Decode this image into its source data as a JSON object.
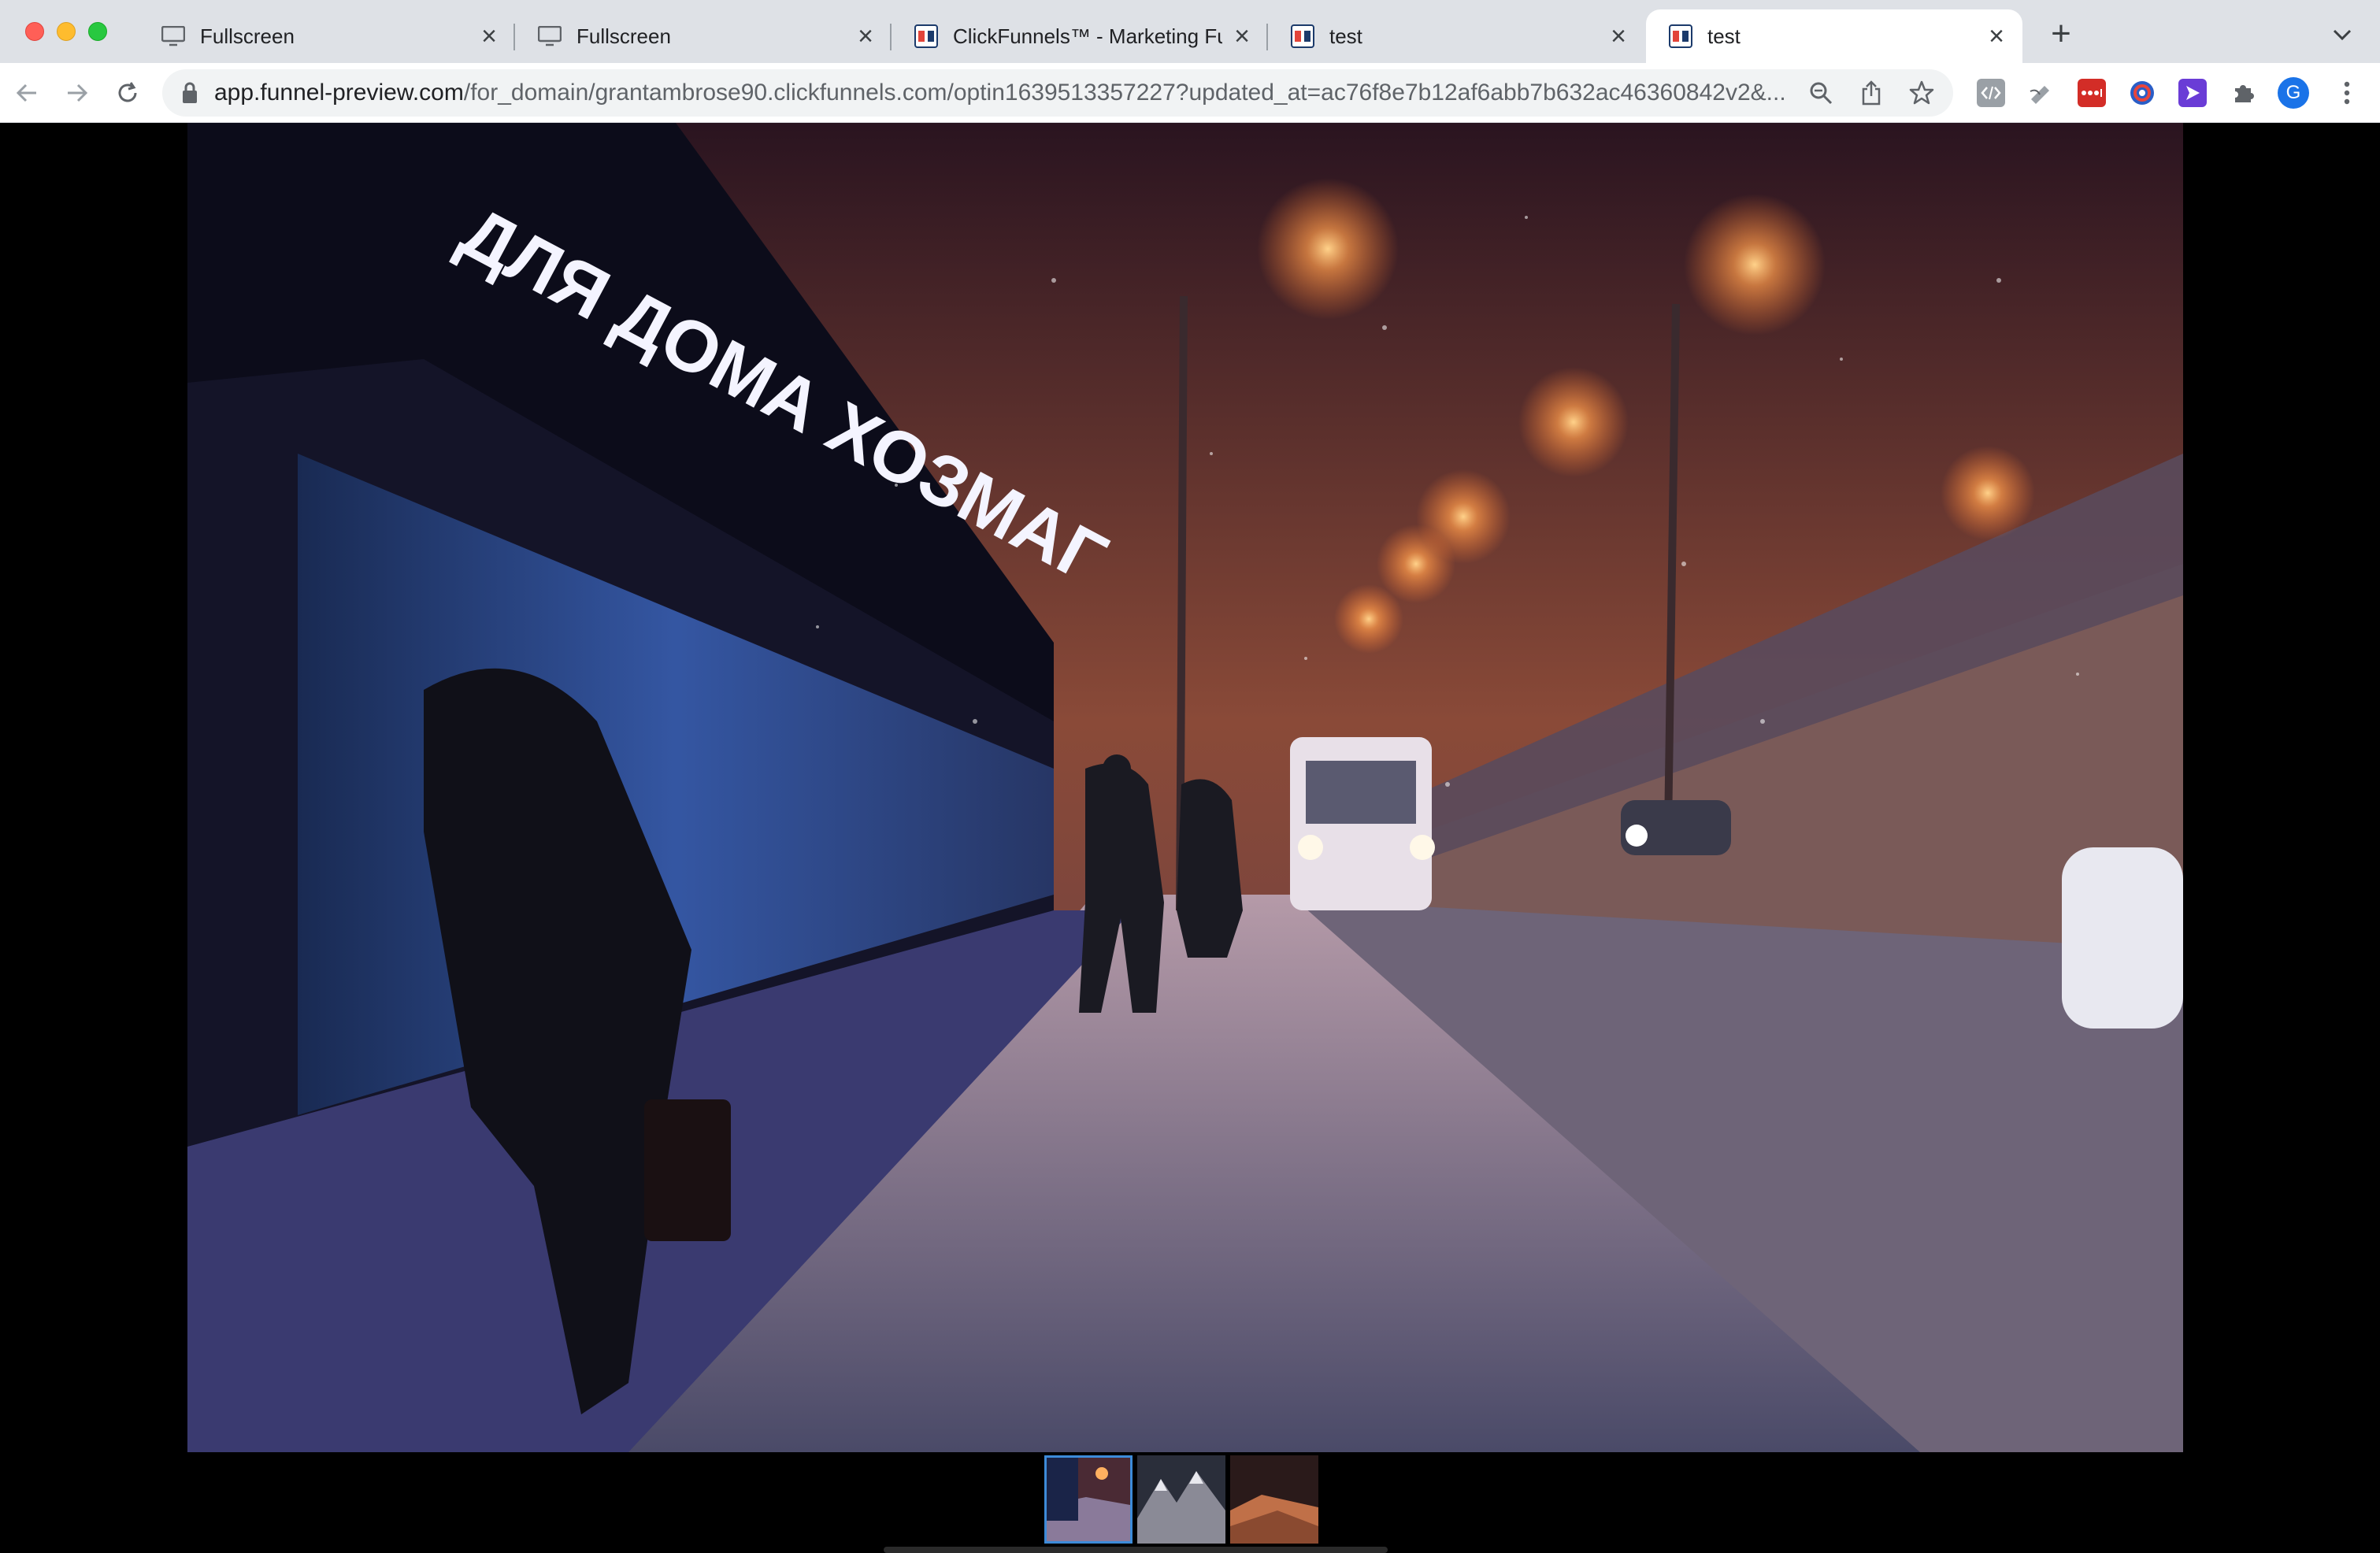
{
  "tabs": [
    {
      "title": "Fullscreen",
      "icon": "monitor-icon",
      "active": false
    },
    {
      "title": "Fullscreen",
      "icon": "monitor-icon",
      "active": false
    },
    {
      "title": "ClickFunnels™ - Marketing Fun",
      "icon": "clickfunnels-icon",
      "active": false
    },
    {
      "title": "test",
      "icon": "clickfunnels-icon",
      "active": false
    },
    {
      "title": "test",
      "icon": "clickfunnels-icon",
      "active": true
    }
  ],
  "new_tab_label": "+",
  "tab_close_glyph": "×",
  "address_bar": {
    "host": "app.funnel-preview.com",
    "path": "/for_domain/grantambrose90.clickfunnels.com/optin1639513357227?updated_at=ac76f8e7b12af6abb7b632ac46360842v2&..."
  },
  "profile_initial": "G",
  "colors": {
    "tab_strip": "#dee1e6",
    "toolbar": "#ffffff",
    "omnibox": "#f1f3f4",
    "page_background": "#000000",
    "thumb_selected_border": "#3d8bd9",
    "avatar": "#1a73e8"
  },
  "gallery": {
    "main_image_icon": "snowy-night-street-photo",
    "thumbnails": [
      {
        "icon": "snowy-street-thumb",
        "selected": true
      },
      {
        "icon": "mountain-thumb",
        "selected": false
      },
      {
        "icon": "desert-night-thumb",
        "selected": false
      }
    ]
  },
  "extensions": [
    "code-icon",
    "pen-icon",
    "lastpass-icon",
    "chrome-extension-icon",
    "arrow-extension-icon",
    "puzzle-icon"
  ]
}
